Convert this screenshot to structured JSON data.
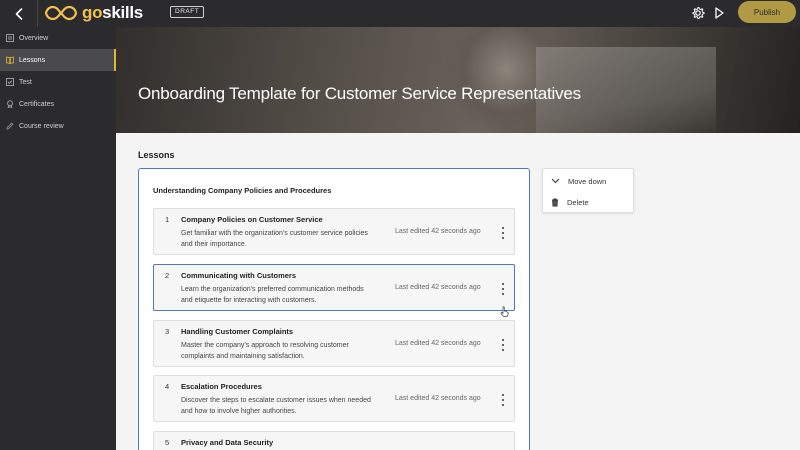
{
  "topbar": {
    "logo_go": "go",
    "logo_skills": "skills",
    "draft_label": "DRAFT",
    "publish_label": "Publish",
    "icons": [
      "back-arrow-icon",
      "gear-icon",
      "play-icon"
    ]
  },
  "sidebar": {
    "items": [
      {
        "label": "Overview",
        "icon": "overview-icon"
      },
      {
        "label": "Lessons",
        "icon": "book-icon",
        "active": true
      },
      {
        "label": "Test",
        "icon": "test-icon"
      },
      {
        "label": "Certificates",
        "icon": "certificate-icon"
      },
      {
        "label": "Course review",
        "icon": "edit-icon"
      }
    ]
  },
  "hero": {
    "title": "Onboarding Template for Customer Service Representatives"
  },
  "main": {
    "section_heading": "Lessons",
    "group": {
      "title": "Understanding Company Policies and Procedures",
      "lessons": [
        {
          "number": "1",
          "title": "Company Policies on Customer Service",
          "description": "Get familiar with the organization's customer service policies and their importance.",
          "edited": "Last edited 42 seconds ago"
        },
        {
          "number": "2",
          "title": "Communicating with Customers",
          "description": "Learn the organization's preferred communication methods and etiquette for interacting with customers.",
          "edited": "Last edited 42 seconds ago",
          "selected": true
        },
        {
          "number": "3",
          "title": "Handling Customer Complaints",
          "description": "Master the company's approach to resolving customer complaints and maintaining satisfaction.",
          "edited": "Last edited 42 seconds ago"
        },
        {
          "number": "4",
          "title": "Escalation Procedures",
          "description": "Discover the steps to escalate customer issues when needed and how to involve higher authorities.",
          "edited": "Last edited 42 seconds ago"
        },
        {
          "number": "5",
          "title": "Privacy and Data Security",
          "description": "",
          "edited": ""
        }
      ]
    }
  },
  "menu": {
    "items": [
      {
        "label": "Move down",
        "icon": "chevron-down-icon"
      },
      {
        "label": "Delete",
        "icon": "trash-icon"
      }
    ]
  },
  "colors": {
    "topbar_bg": "#2b2b2e",
    "accent_gold": "#e2b53a",
    "publish_bg": "#b29a45",
    "selection_blue": "#4a78d1"
  }
}
